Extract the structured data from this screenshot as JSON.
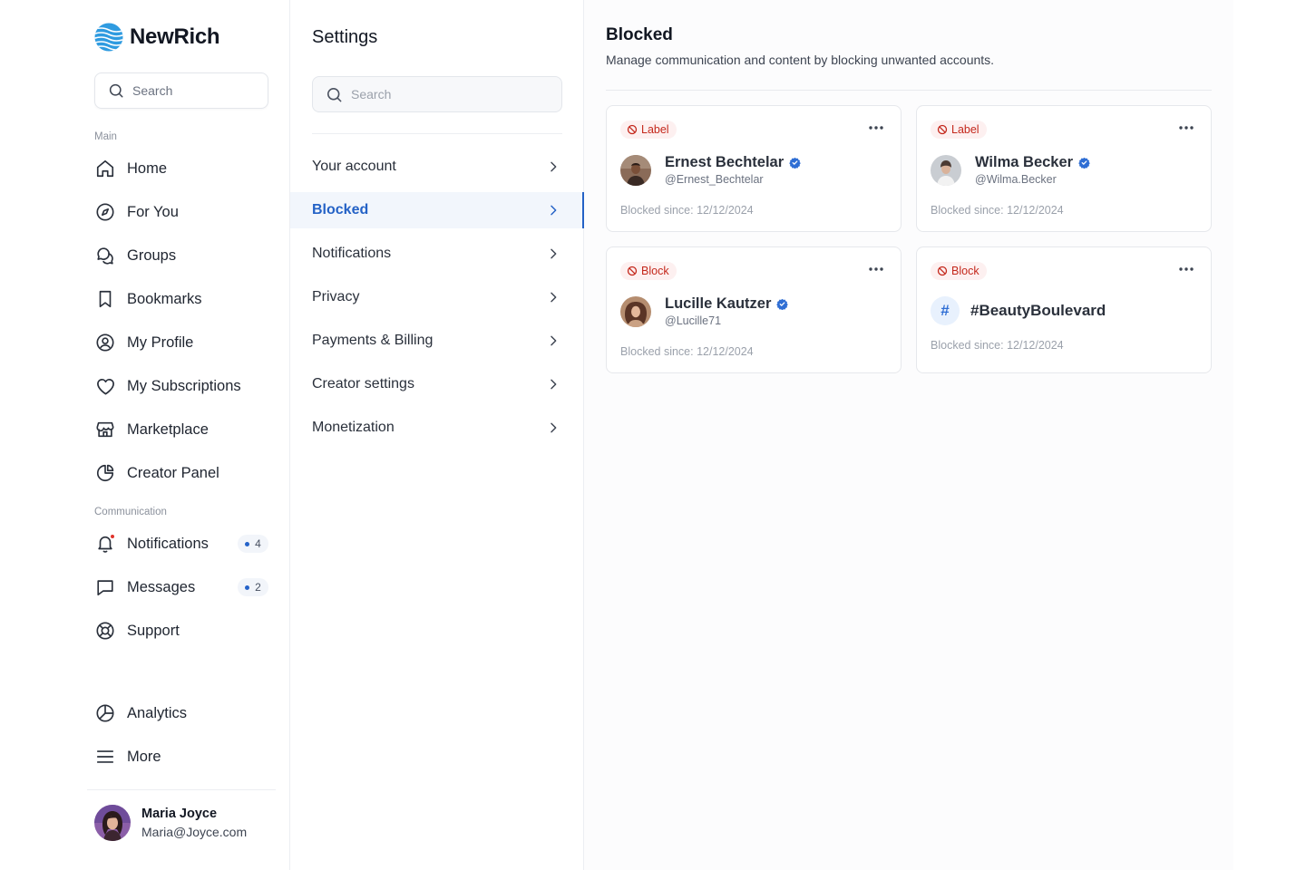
{
  "brand": {
    "name": "NewRich",
    "logo_icon": "globe-stripes-icon",
    "accent": "#2f9be0"
  },
  "sidebar": {
    "search_placeholder": "Search",
    "main_label": "Main",
    "main_items": [
      {
        "label": "Home",
        "icon": "home-icon"
      },
      {
        "label": "For You",
        "icon": "compass-icon"
      },
      {
        "label": "Groups",
        "icon": "chat-bubbles-icon"
      },
      {
        "label": "Bookmarks",
        "icon": "bookmark-icon"
      },
      {
        "label": "My Profile",
        "icon": "user-circle-icon"
      },
      {
        "label": "My Subscriptions",
        "icon": "heart-icon"
      },
      {
        "label": "Marketplace",
        "icon": "store-icon"
      },
      {
        "label": "Creator Panel",
        "icon": "pie-chart-icon"
      }
    ],
    "communication_label": "Communication",
    "communication_items": [
      {
        "label": "Notifications",
        "icon": "bell-icon",
        "count": "4"
      },
      {
        "label": "Messages",
        "icon": "message-square-icon",
        "count": "2"
      },
      {
        "label": "Support",
        "icon": "lifebuoy-icon"
      }
    ],
    "bottom_items": [
      {
        "label": "Analytics",
        "icon": "clock-pie-icon"
      },
      {
        "label": "More",
        "icon": "menu-icon"
      }
    ],
    "user": {
      "name": "Maria Joyce",
      "email": "Maria@Joyce.com"
    }
  },
  "settings": {
    "title": "Settings",
    "search_placeholder": "Search",
    "items": [
      {
        "label": "Your account"
      },
      {
        "label": "Blocked",
        "active": true
      },
      {
        "label": "Notifications"
      },
      {
        "label": "Privacy"
      },
      {
        "label": "Payments & Billing"
      },
      {
        "label": "Creator settings"
      },
      {
        "label": "Monetization"
      }
    ]
  },
  "main": {
    "title": "Blocked",
    "subtitle": "Manage communication and content by blocking unwanted accounts.",
    "cards": [
      {
        "tag": "Label",
        "name": "Ernest Bechtelar",
        "handle": "@Ernest_Bechtelar",
        "verified": true,
        "since": "Blocked since: 12/12/2024"
      },
      {
        "tag": "Label",
        "name": "Wilma Becker",
        "handle": "@Wilma.Becker",
        "verified": true,
        "since": "Blocked since: 12/12/2024"
      },
      {
        "tag": "Block",
        "name": "Lucille Kautzer",
        "handle": "@Lucille71",
        "verified": true,
        "since": "Blocked since: 12/12/2024"
      },
      {
        "tag": "Block",
        "hashtag_symbol": "#",
        "name": "#BeautyBoulevard",
        "since": "Blocked since: 12/12/2024"
      }
    ]
  },
  "colors": {
    "primary": "#2462c6",
    "danger": "#c4281c",
    "verified": "#2f6ed4"
  }
}
